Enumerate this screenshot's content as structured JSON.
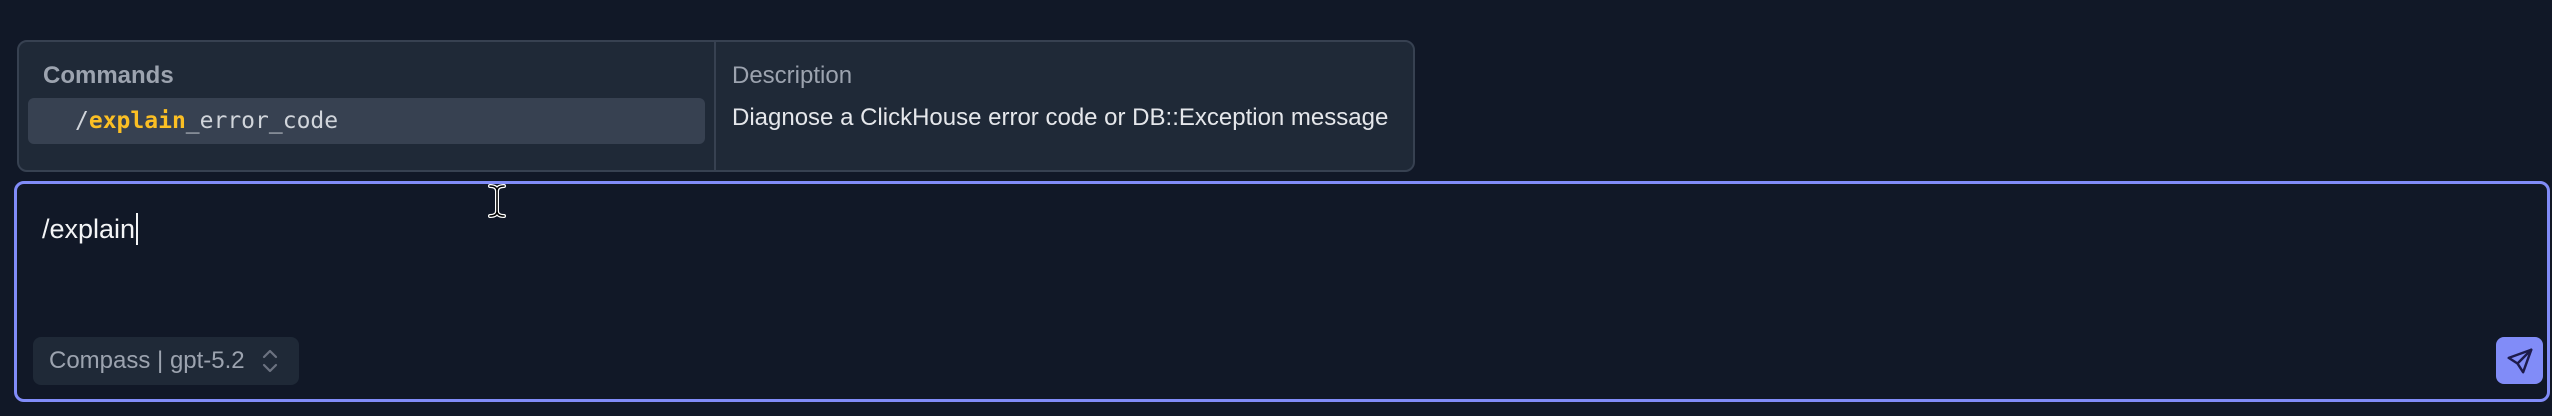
{
  "command_palette": {
    "commands_header": "Commands",
    "description_header": "Description",
    "commands": [
      {
        "slash": "/",
        "match": "explain",
        "rest": "_error_code",
        "description": "Diagnose a ClickHouse error code or DB::Exception message"
      }
    ]
  },
  "chat_input": {
    "value": "/explain"
  },
  "model_select": {
    "label": "Compass | gpt-5.2"
  },
  "icons": {
    "send": "send-icon",
    "chevron": "chevron-up-down-icon",
    "cursor": "text-cursor-icon"
  },
  "colors": {
    "background": "#111827",
    "accent": "#818cf8",
    "match_highlight": "#fbbf24"
  }
}
